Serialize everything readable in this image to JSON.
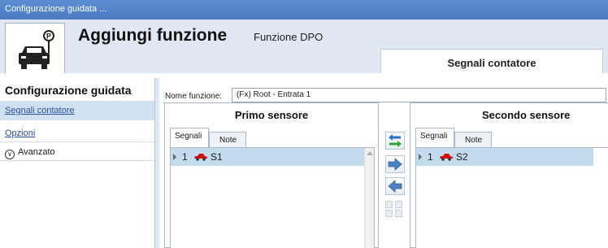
{
  "window": {
    "title": "Configurazione guidata ..."
  },
  "header": {
    "title": "Aggiungi funzione",
    "subtitle": "Funzione DPO",
    "active_tab": "Segnali contatore",
    "logo_icon": "parking-car-icon"
  },
  "sidebar": {
    "title": "Configurazione guidata",
    "items": [
      {
        "label": "Segnali contatore",
        "active": true
      },
      {
        "label": "Opzioni",
        "active": false
      },
      {
        "label": "Avanzato",
        "icon": "chevron-down-circle-icon"
      }
    ]
  },
  "form": {
    "name_label": "Nome funzione:",
    "name_value": "(Fx) Root - Entrata 1"
  },
  "panels": {
    "first": {
      "title": "Primo sensore",
      "tabs": [
        "Segnali",
        "Note"
      ],
      "rows": [
        {
          "index": "1",
          "name": "S1",
          "icon": "car-icon"
        }
      ]
    },
    "second": {
      "title": "Secondo sensore",
      "tabs": [
        "Segnali",
        "Note"
      ],
      "rows": [
        {
          "index": "1",
          "name": "S2",
          "icon": "car-icon"
        }
      ]
    }
  },
  "buttons": [
    {
      "name": "swap-button",
      "icon": "swap-arrows-icon"
    },
    {
      "name": "move-right-button",
      "icon": "arrow-right-icon"
    },
    {
      "name": "move-left-button",
      "icon": "arrow-left-icon"
    }
  ],
  "colors": {
    "accent": "#4a7ac0",
    "selected_row": "#c2dcee",
    "sidebar_active": "#cfe0f3"
  }
}
